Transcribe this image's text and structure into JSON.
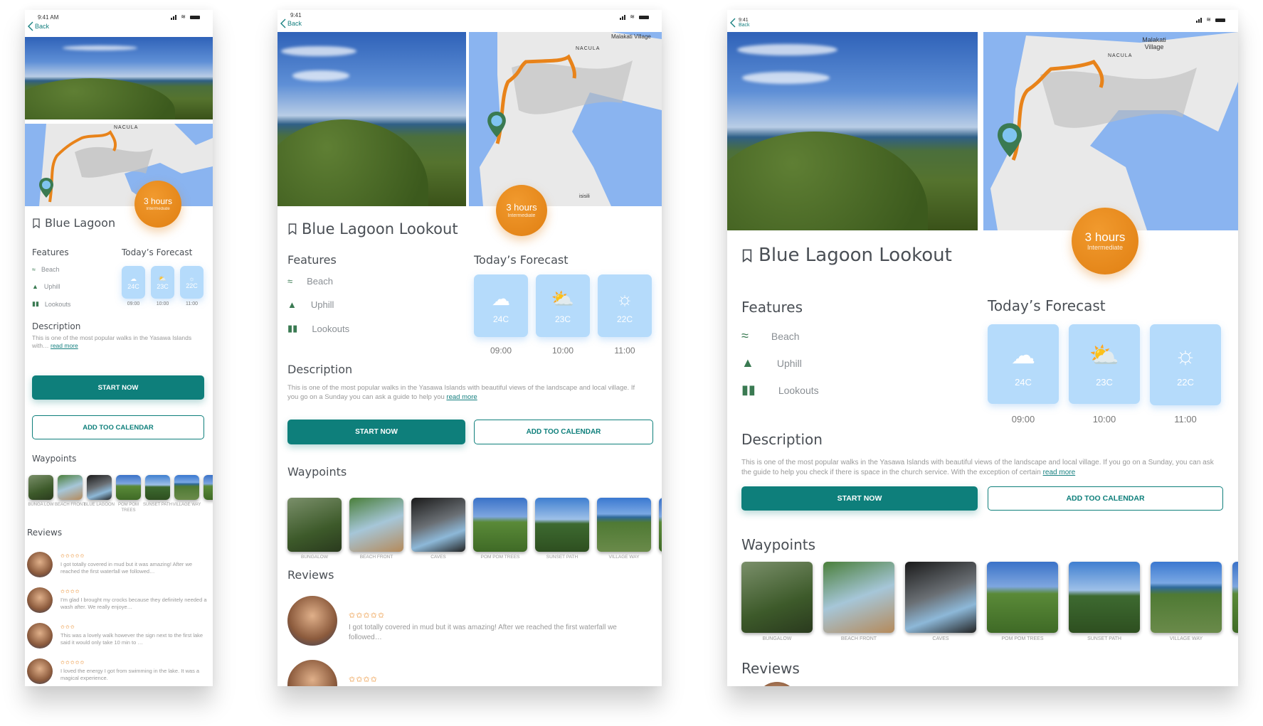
{
  "status": {
    "time_phone": "9:41 AM",
    "time_tablet": "9:41"
  },
  "nav": {
    "back_label": "Back"
  },
  "map": {
    "labels": [
      "NACULA",
      "Malakati Village",
      "isisili"
    ]
  },
  "badge": {
    "duration": "3 hours",
    "difficulty": "Intermediate"
  },
  "walk": {
    "title_short": "Blue Lagoon",
    "title_full": "Blue Lagoon Lookout"
  },
  "features": {
    "heading": "Features",
    "items": [
      {
        "icon": "swimmer-icon",
        "label": "Beach"
      },
      {
        "icon": "mountain-icon",
        "label": "Uphill"
      },
      {
        "icon": "binoculars-icon",
        "label": "Lookouts"
      }
    ]
  },
  "forecast": {
    "heading": "Today’s Forecast",
    "items": [
      {
        "icon": "cloud-icon",
        "temp": "24C",
        "time": "09:00"
      },
      {
        "icon": "partly-sunny-icon",
        "temp": "23C",
        "time": "10:00"
      },
      {
        "icon": "sun-icon",
        "temp": "22C",
        "time": "11:00"
      }
    ]
  },
  "description": {
    "heading": "Description",
    "text_phone": "This is one of the most popular walks in the Yasawa Islands with…",
    "text_medium": "This is one of the most popular walks in the Yasawa Islands with beautiful views of the landscape and local village.  If you go on a Sunday you can ask a guide to help you",
    "text_large": "This is one of the most popular walks in the Yasawa Islands with beautiful views of the landscape and local village.  If you go on a Sunday, you can ask the guide to help you check if there is space in the church service.  With the exception of certain",
    "read_more": "read more"
  },
  "actions": {
    "start": "START NOW",
    "calendar": "ADD TOO CALENDAR"
  },
  "waypoints": {
    "heading": "Waypoints",
    "phone_items": [
      "BUNGA LOW",
      "BEACH FRONT",
      "BLUE LAGOON",
      "POM POM TREES",
      "SUNSET PATH",
      "VILLAGE WAY"
    ],
    "tablet_items": [
      "BUNGALOW",
      "BEACH FRONT",
      "CAVES",
      "POM POM TREES",
      "SUNSET PATH",
      "VILLAGE WAY"
    ]
  },
  "reviews": {
    "heading": "Reviews",
    "items": [
      {
        "stars": 5,
        "stars_text": "✩✩✩✩✩",
        "text_phone": "I got totally covered in mud but it was amazing! After we reached the first waterfall we followed…",
        "text_tablet": "I got totally covered in mud but it was amazing!  After we reached the first waterfall we followed…"
      },
      {
        "stars": 4,
        "stars_text": "✩✩✩✩",
        "text_phone": "I’m glad I brought my crocks because they definitely needed a wash after.  We really enjoye…"
      },
      {
        "stars": 3,
        "stars_text": "✩✩✩",
        "text_phone": "This was a lovely walk however the sign next to the first lake said it would only take 10 min to …"
      },
      {
        "stars": 5,
        "stars_text": "✩✩✩✩✩",
        "text_phone": "I loved the energy I got from swimming in the lake. It was a magical experience."
      }
    ]
  },
  "colors": {
    "primary": "#0e7f7b",
    "accent": "#e8831a",
    "forecast": "#b5dbfb",
    "feature_icon": "#3a7a52"
  }
}
